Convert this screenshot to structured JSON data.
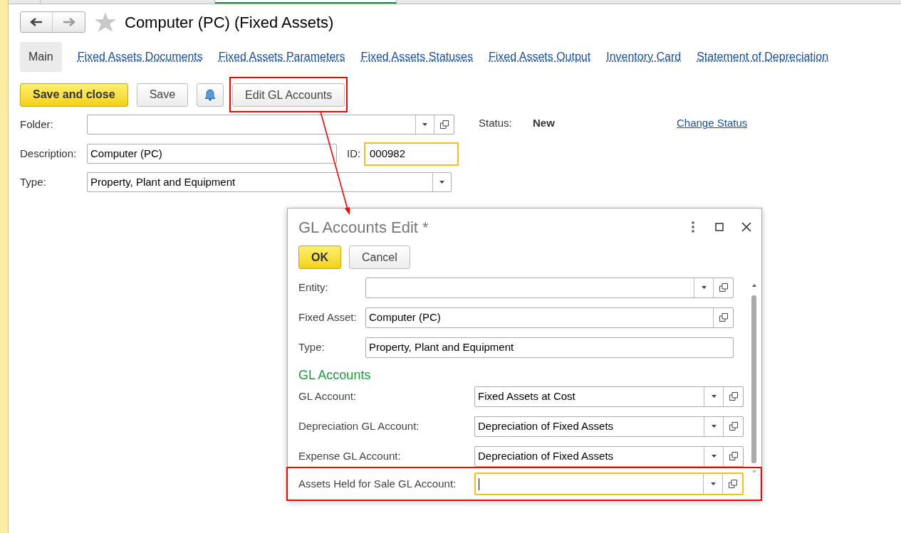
{
  "title": "Computer (PC) (Fixed Assets)",
  "tabs": [
    {
      "label": "Main",
      "selected": true
    },
    {
      "label": "Fixed Assets Documents",
      "selected": false
    },
    {
      "label": "Fixed Assets Parameters",
      "selected": false
    },
    {
      "label": "Fixed Assets Statuses",
      "selected": false
    },
    {
      "label": "Fixed Assets Output",
      "selected": false
    },
    {
      "label": "Inventory Card",
      "selected": false
    },
    {
      "label": "Statement of Depreciation",
      "selected": false
    }
  ],
  "toolbar": [
    {
      "kind": "primary",
      "label": "Save and close",
      "highlighted": false
    },
    {
      "kind": "default",
      "label": "Save",
      "highlighted": false
    },
    {
      "kind": "bell",
      "highlighted": false
    },
    {
      "kind": "default",
      "label": "Edit GL Accounts",
      "highlighted": true
    }
  ],
  "folder": {
    "label": "Folder:"
  },
  "description": {
    "label": "Description:",
    "value": "Computer (PC)"
  },
  "id": {
    "label": "ID:",
    "value": "000982",
    "focused": true
  },
  "type": {
    "label": "Type:",
    "value": "Property, Plant and Equipment"
  },
  "status": {
    "label": "Status:",
    "value": "New",
    "link": "Change Status"
  },
  "dialog": {
    "title": "GL Accounts Edit *",
    "buttons": [
      {
        "kind": "primary",
        "label": "OK"
      },
      {
        "kind": "default",
        "label": "Cancel"
      }
    ],
    "fields": [
      {
        "label": "Entity:",
        "dropdown": true,
        "open": true
      },
      {
        "label": "Fixed Asset:",
        "value": "Computer (PC)",
        "dropdown": false,
        "open": true
      },
      {
        "label": "Type:",
        "value": "Property, Plant and Equipment",
        "dropdown": false,
        "open": false
      }
    ],
    "section": "GL Accounts",
    "accounts": [
      {
        "label": "GL Account:",
        "value": "Fixed Assets at Cost",
        "focused": false,
        "highlighted": false
      },
      {
        "label": "Depreciation GL Account:",
        "value": "Depreciation of Fixed Assets",
        "focused": false,
        "highlighted": false
      },
      {
        "label": "Expense GL Account:",
        "value": "Depreciation of Fixed Assets",
        "focused": false,
        "highlighted": false
      },
      {
        "label": "Assets Held for Sale GL Account:",
        "focused": true,
        "highlighted": true
      }
    ]
  }
}
